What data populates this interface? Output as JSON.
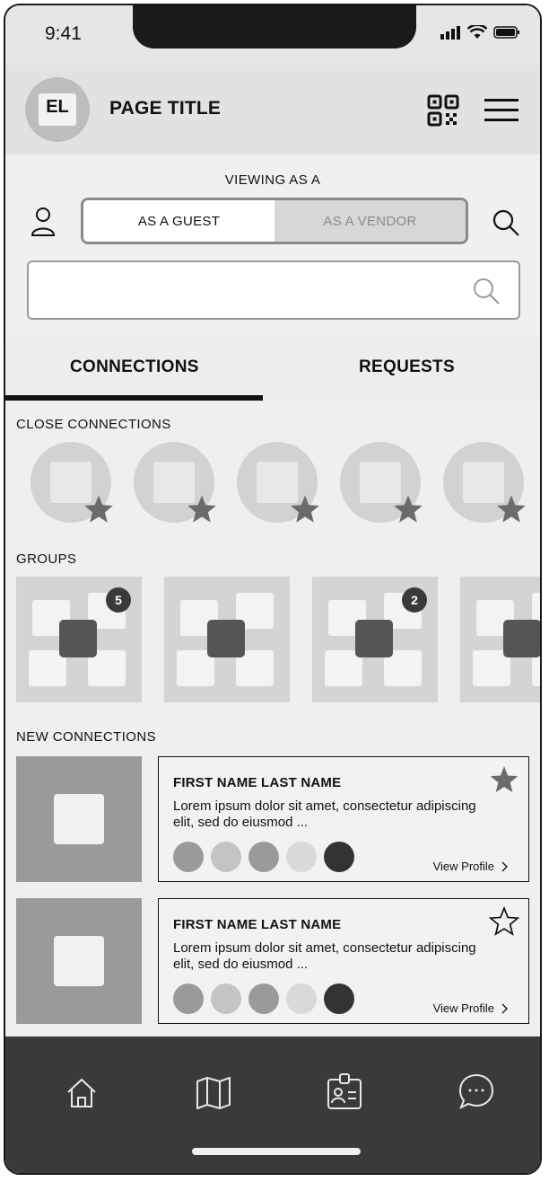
{
  "status_bar": {
    "time": "9:41"
  },
  "header": {
    "avatar_initials": "EL",
    "title": "PAGE TITLE"
  },
  "viewing": {
    "label": "VIEWING AS A",
    "options": [
      "AS A GUEST",
      "AS A VENDOR"
    ],
    "selected": "AS A GUEST"
  },
  "search": {
    "value": "",
    "placeholder": ""
  },
  "tabs": [
    {
      "label": "CONNECTIONS",
      "active": true
    },
    {
      "label": "REQUESTS",
      "active": false
    }
  ],
  "close_connections": {
    "title": "CLOSE CONNECTIONS",
    "count_visible": 5
  },
  "groups": {
    "title": "GROUPS",
    "items": [
      {
        "badge": "5"
      },
      {
        "badge": ""
      },
      {
        "badge": "2"
      },
      {
        "badge": ""
      }
    ]
  },
  "new_connections": {
    "title": "NEW CONNECTIONS",
    "items": [
      {
        "name": "FIRST NAME LAST NAME",
        "description": "Lorem ipsum dolor sit amet, consectetur adipiscing elit, sed do eiusmod ...",
        "starred": true,
        "link": "View Profile",
        "dot_colors": [
          "#9a9a9a",
          "#c4c4c4",
          "#9a9a9a",
          "#d9d9d9",
          "#333333"
        ]
      },
      {
        "name": "FIRST NAME LAST NAME",
        "description": "Lorem ipsum dolor sit amet, consectetur adipiscing elit, sed do eiusmod ...",
        "starred": false,
        "link": "View Profile",
        "dot_colors": [
          "#9a9a9a",
          "#c4c4c4",
          "#9a9a9a",
          "#d9d9d9",
          "#333333"
        ]
      }
    ]
  },
  "bottom_nav": {
    "items": [
      {
        "icon": "home-icon"
      },
      {
        "icon": "map-icon"
      },
      {
        "icon": "id-badge-icon"
      },
      {
        "icon": "chat-icon"
      }
    ]
  }
}
